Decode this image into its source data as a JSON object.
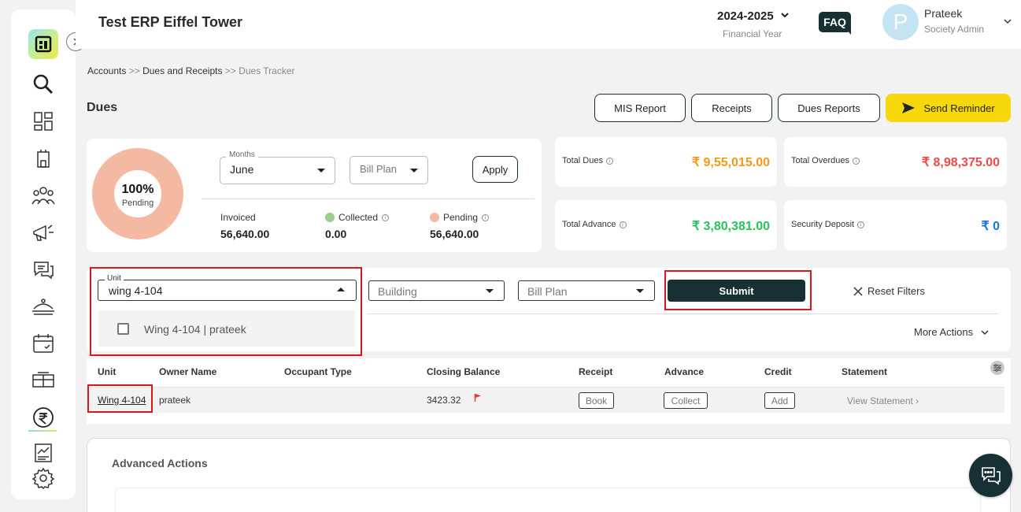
{
  "header": {
    "app_title": "Test ERP Eiffel Tower",
    "financial_year": "2024-2025",
    "financial_year_label": "Financial Year",
    "faq_label": "FAQ",
    "user": {
      "initial": "P",
      "name": "Prateek",
      "role": "Society Admin"
    }
  },
  "breadcrumb": {
    "item1": "Accounts",
    "sep": ">>",
    "item2": "Dues and Receipts",
    "item3": "Dues Tracker"
  },
  "page": {
    "title": "Dues"
  },
  "top_actions": {
    "mis_report": "MIS Report",
    "receipts": "Receipts",
    "dues_reports": "Dues Reports",
    "send_reminder": "Send Reminder"
  },
  "summary": {
    "donut": {
      "percent": "100%",
      "label": "Pending",
      "pending_fraction": 1.0
    },
    "months_label": "Months",
    "months_value": "June",
    "bill_plan_placeholder": "Bill Plan",
    "apply_label": "Apply",
    "invoiced": {
      "label": "Invoiced",
      "value": "56,640.00"
    },
    "collected": {
      "label": "Collected",
      "value": "0.00"
    },
    "pending": {
      "label": "Pending",
      "value": "56,640.00"
    }
  },
  "kpis": {
    "total_dues": {
      "label": "Total Dues",
      "value": "₹ 9,55,015.00"
    },
    "total_overdues": {
      "label": "Total Overdues",
      "value": "₹ 8,98,375.00"
    },
    "total_advance": {
      "label": "Total Advance",
      "value": "₹ 3,80,381.00"
    },
    "security_deposit": {
      "label": "Security Deposit",
      "value": "₹ 0"
    }
  },
  "filters": {
    "unit_label": "Unit",
    "unit_value": "wing 4-104",
    "unit_option": "Wing 4-104 | prateek",
    "building_placeholder": "Building",
    "bill_plan_placeholder": "Bill Plan",
    "submit_label": "Submit",
    "reset_label": "Reset Filters",
    "more_actions_label": "More Actions"
  },
  "table": {
    "headers": {
      "unit": "Unit",
      "owner": "Owner Name",
      "occupant": "Occupant Type",
      "closing": "Closing Balance",
      "receipt": "Receipt",
      "advance": "Advance",
      "credit": "Credit",
      "statement": "Statement"
    },
    "row": {
      "unit": "Wing 4-104",
      "owner": "prateek",
      "occupant": "",
      "closing": "3423.32",
      "receipt_btn": "Book",
      "advance_btn": "Collect",
      "credit_btn": "Add",
      "statement_link": "View Statement ›"
    }
  },
  "advanced": {
    "title": "Advanced Actions"
  },
  "colors": {
    "brand_dark": "#163034",
    "accent_yellow": "#f6d80c",
    "pending_peach": "#f4b9a2",
    "collected_green": "#9bcf8a",
    "dues_orange": "#f59a16",
    "overdues_red": "#ee4a4a",
    "advance_green": "#27c35c",
    "deposit_blue": "#1a73e8",
    "highlight_red": "#e0141a"
  },
  "icons": {
    "sidebar": [
      "app-logo-icon",
      "search-icon",
      "dashboard-icon",
      "building-icon",
      "members-icon",
      "announcement-icon",
      "chat-icon",
      "facility-icon",
      "calendar-icon",
      "parking-icon",
      "rupee-icon",
      "reports-icon",
      "settings-icon"
    ]
  }
}
